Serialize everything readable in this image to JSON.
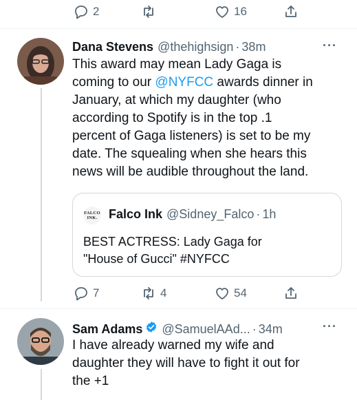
{
  "top_actions": {
    "reply_count": "2",
    "retweet_count": "",
    "like_count": "16"
  },
  "tweet1": {
    "name": "Dana Stevens",
    "handle": "@thehighsign",
    "separator": "·",
    "time": "38m",
    "more": "···",
    "text_before_mention": "This award may mean Lady Gaga is\ncoming to our ",
    "mention": "@NYFCC",
    "text_after_mention": " awards dinner in\nJanuary, at which my daughter (who\naccording to Spotify is in the top .1\npercent of Gaga listeners) is set to be my\ndate. The squealing when she hears this\nnews will be audible throughout the land.",
    "quote": {
      "avatar_text": "FALCO\nINK.",
      "name": "Falco Ink",
      "handle": "@Sidney_Falco",
      "separator": "·",
      "time": "1h",
      "text": "BEST ACTRESS: Lady Gaga for\n\"House of Gucci\" #NYFCC"
    },
    "actions": {
      "reply_count": "7",
      "retweet_count": "4",
      "like_count": "54"
    }
  },
  "tweet2": {
    "name": "Sam Adams",
    "handle": "@SamuelAAd...",
    "separator": "·",
    "time": "34m",
    "more": "···",
    "text": "I have already warned my wife and\ndaughter they will have to fight it out for\nthe +1"
  },
  "colors": {
    "accent": "#1d9bf0",
    "secondary_text": "#536471",
    "border": "#cfd9de"
  }
}
